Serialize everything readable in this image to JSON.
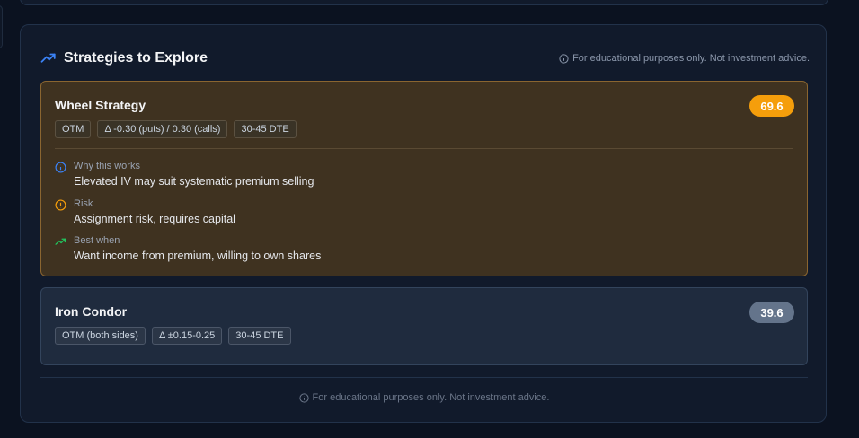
{
  "panel": {
    "title": "Strategies to Explore",
    "disclaimer": "For educational purposes only. Not investment advice."
  },
  "strategies": [
    {
      "name": "Wheel Strategy",
      "score": "69.6",
      "tags": [
        "OTM",
        "Δ -0.30 (puts) / 0.30 (calls)",
        "30-45 DTE"
      ],
      "why_label": "Why this works",
      "why_text": "Elevated IV may suit systematic premium selling",
      "risk_label": "Risk",
      "risk_text": "Assignment risk, requires capital",
      "best_label": "Best when",
      "best_text": "Want income from premium, willing to own shares"
    },
    {
      "name": "Iron Condor",
      "score": "39.6",
      "tags": [
        "OTM (both sides)",
        "Δ ±0.15-0.25",
        "30-45 DTE"
      ]
    }
  ],
  "footer": {
    "disclaimer": "For educational purposes only. Not investment advice."
  },
  "icons": {
    "title": "trending-up-icon",
    "why": "info-icon",
    "risk": "alert-circle-icon",
    "best": "trending-up-icon"
  },
  "colors": {
    "accent_blue": "#3b82f6",
    "score_high": "#f59e0b",
    "score_low": "#64748b",
    "best_green": "#22c55e"
  }
}
